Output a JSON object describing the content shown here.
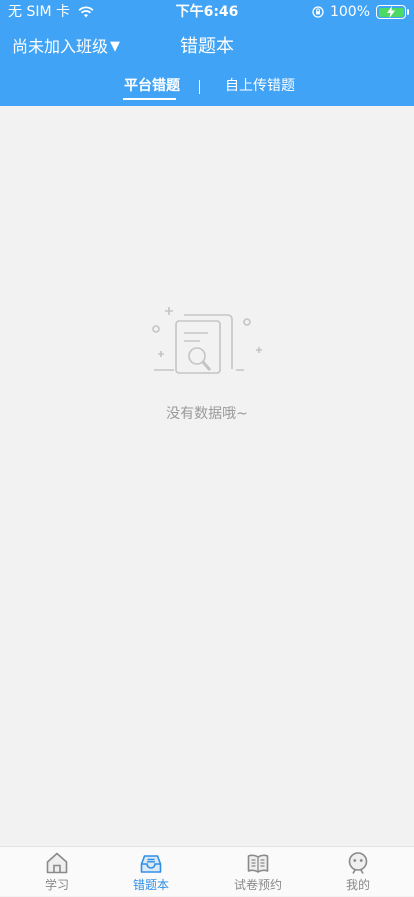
{
  "status_bar": {
    "carrier": "无 SIM 卡",
    "time": "下午6:46",
    "battery": "100%"
  },
  "header": {
    "class_selector": "尚未加入班级",
    "class_selector_caret": "▼",
    "title": "错题本"
  },
  "tabs": [
    {
      "label": "平台错题",
      "active": true
    },
    {
      "label": "自上传错题",
      "active": false
    }
  ],
  "empty_state": {
    "icon": "empty-document-search-icon",
    "message": "没有数据哦~"
  },
  "tabbar": [
    {
      "label": "学习",
      "icon": "home-icon",
      "active": false
    },
    {
      "label": "错题本",
      "icon": "inbox-tray-icon",
      "active": true
    },
    {
      "label": "试卷预约",
      "icon": "open-book-icon",
      "active": false
    },
    {
      "label": "我的",
      "icon": "profile-face-icon",
      "active": false
    }
  ],
  "colors": {
    "header_blue": "#41a3f5",
    "tabbar_active": "#2f8fe6",
    "background": "#f2f2f2"
  }
}
